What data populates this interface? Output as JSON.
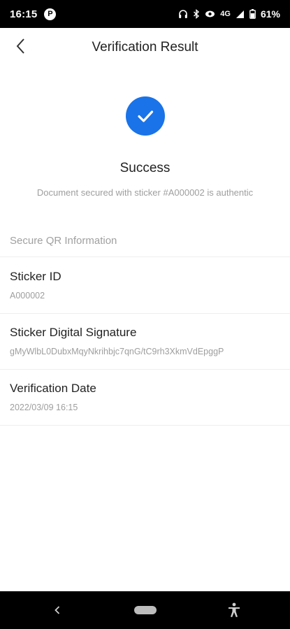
{
  "status_bar": {
    "time": "16:15",
    "app_badge": "P",
    "network": "4G",
    "battery": "61%",
    "icons": [
      "headset-icon",
      "bluetooth-icon",
      "eye-icon",
      "signal-icon",
      "battery-icon"
    ]
  },
  "app_bar": {
    "title": "Verification Result",
    "back_icon": "chevron-left-icon"
  },
  "result": {
    "icon": "check-circle-icon",
    "accent_color": "#1a73e8",
    "title": "Success",
    "message": "Document secured with sticker #A000002 is authentic"
  },
  "section": {
    "title": "Secure QR Information"
  },
  "info_rows": [
    {
      "label": "Sticker ID",
      "value": "A000002"
    },
    {
      "label": "Sticker Digital Signature",
      "value": "gMyWlbL0DubxMqyNkrihbjc7qnG/tC9rh3XkmVdEpggP"
    },
    {
      "label": "Verification Date",
      "value": "2022/03/09 16:15"
    }
  ],
  "nav_bar": {
    "icons": [
      "nav-back-icon",
      "home-pill-icon",
      "accessibility-icon"
    ]
  }
}
